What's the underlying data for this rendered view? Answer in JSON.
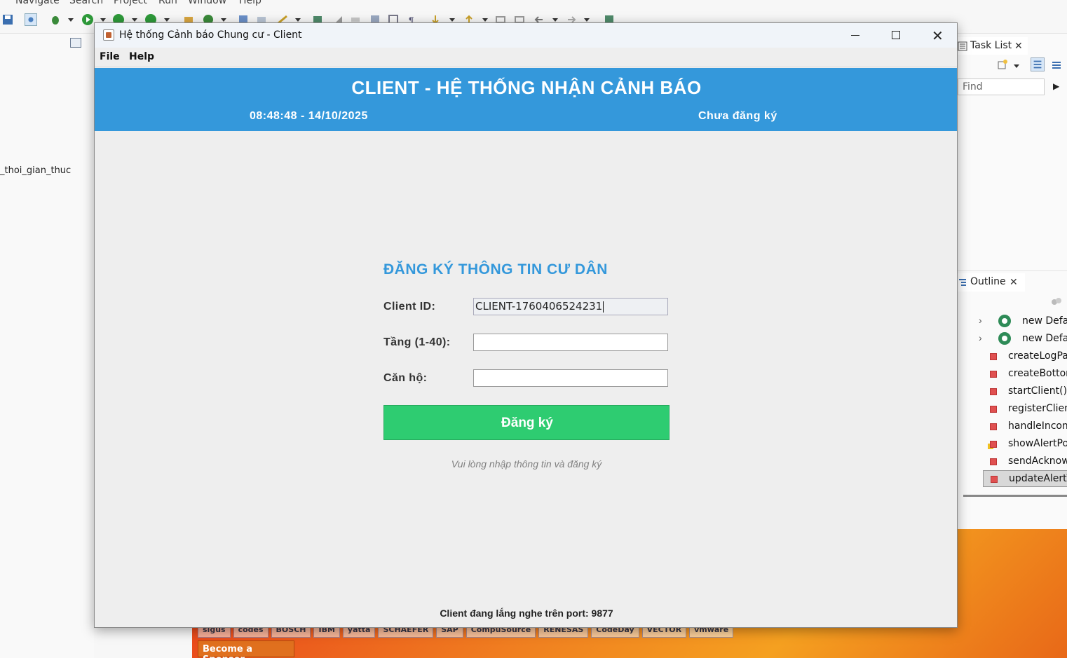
{
  "eclipse": {
    "menu": [
      "Navigate",
      "Search",
      "Project",
      "Run",
      "Window",
      "Help"
    ],
    "left_tree_item": "_thoi_gian_thuc",
    "task_list": {
      "tab_label": "Task List",
      "find_placeholder": "Find"
    },
    "outline": {
      "tab_label": "Outline",
      "items": [
        "new Defa",
        "new Defa",
        "createLogPar",
        "createBottor",
        "startClient() :",
        "registerClien",
        "handleIncom",
        "showAlertPop",
        "sendAcknow",
        "updateAlertT"
      ],
      "selected_index": 9
    },
    "desktop": {
      "sponsors": [
        "sigus",
        "codes",
        "BOSCH",
        "IBM",
        "yatta",
        "SCHAEFER",
        "SAP",
        "CompuSource",
        "RENESAS",
        "CodeDay",
        "VECTOR",
        "vmware"
      ],
      "become_sponsor": "Become a Sponsor"
    }
  },
  "window": {
    "title": "Hệ thống Cảnh báo Chung cư - Client",
    "menu": {
      "file": "File",
      "help": "Help"
    }
  },
  "header": {
    "title": "CLIENT - HỆ THỐNG NHẬN CẢNH BÁO",
    "datetime": "08:48:48 - 14/10/2025",
    "status": "Chưa đăng ký"
  },
  "form": {
    "title": "ĐĂNG KÝ THÔNG TIN CƯ DÂN",
    "client_id": {
      "label": "Client ID:",
      "value": "CLIENT-1760406524231"
    },
    "floor": {
      "label": "Tầng (1-40):",
      "value": ""
    },
    "apartment": {
      "label": "Căn hộ:",
      "value": ""
    },
    "register_button": "Đăng ký",
    "hint": "Vui lòng nhập thông tin và đăng ký"
  },
  "footer": {
    "status": "Client đang lắng nghe trên port: 9877"
  },
  "colors": {
    "header_bg": "#3498db",
    "form_title": "#3498db",
    "register_button": "#2ecc71",
    "window_bg": "#eeeeee"
  }
}
